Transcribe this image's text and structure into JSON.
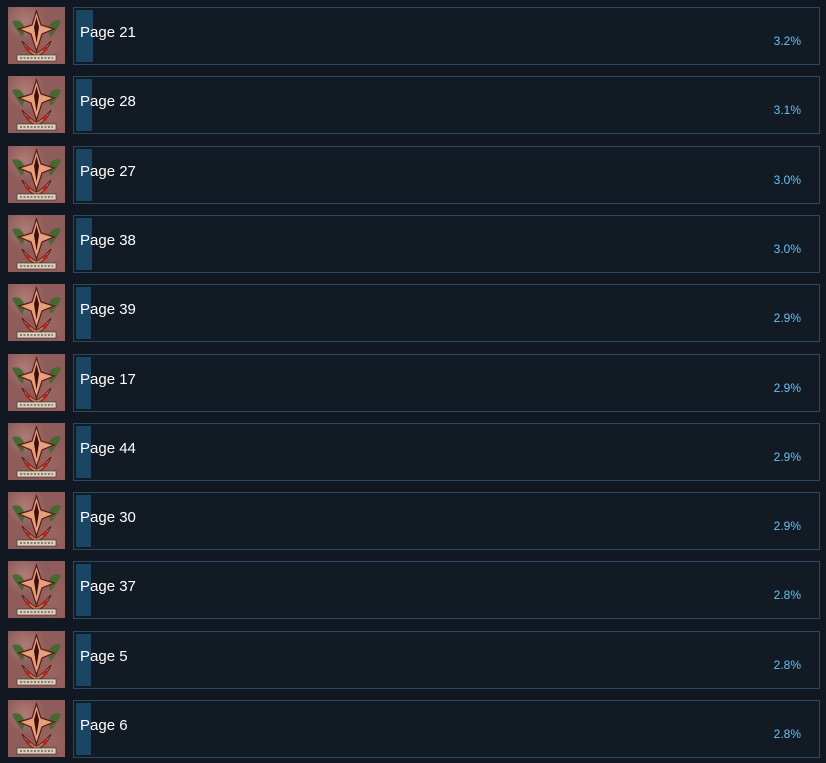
{
  "achievements": [
    {
      "title": "Page 21",
      "percent": "3.2%",
      "progress": 0.032,
      "icon": "demon-crest-icon"
    },
    {
      "title": "Page 28",
      "percent": "3.1%",
      "progress": 0.031,
      "icon": "demon-crest-icon"
    },
    {
      "title": "Page 27",
      "percent": "3.0%",
      "progress": 0.03,
      "icon": "demon-crest-icon"
    },
    {
      "title": "Page 38",
      "percent": "3.0%",
      "progress": 0.03,
      "icon": "demon-crest-icon"
    },
    {
      "title": "Page 39",
      "percent": "2.9%",
      "progress": 0.029,
      "icon": "demon-crest-icon"
    },
    {
      "title": "Page 17",
      "percent": "2.9%",
      "progress": 0.029,
      "icon": "demon-crest-icon"
    },
    {
      "title": "Page 44",
      "percent": "2.9%",
      "progress": 0.029,
      "icon": "demon-crest-icon"
    },
    {
      "title": "Page 30",
      "percent": "2.9%",
      "progress": 0.029,
      "icon": "demon-crest-icon"
    },
    {
      "title": "Page 37",
      "percent": "2.8%",
      "progress": 0.028,
      "icon": "demon-crest-icon"
    },
    {
      "title": "Page 5",
      "percent": "2.8%",
      "progress": 0.028,
      "icon": "demon-crest-icon"
    },
    {
      "title": "Page 6",
      "percent": "2.8%",
      "progress": 0.028,
      "icon": "demon-crest-icon"
    }
  ],
  "colors": {
    "background": "#111821",
    "bar_border": "#2a4a63",
    "bar_fill": "#1a4563",
    "percent_text": "#67c1f5",
    "label_text": "#ffffff"
  }
}
